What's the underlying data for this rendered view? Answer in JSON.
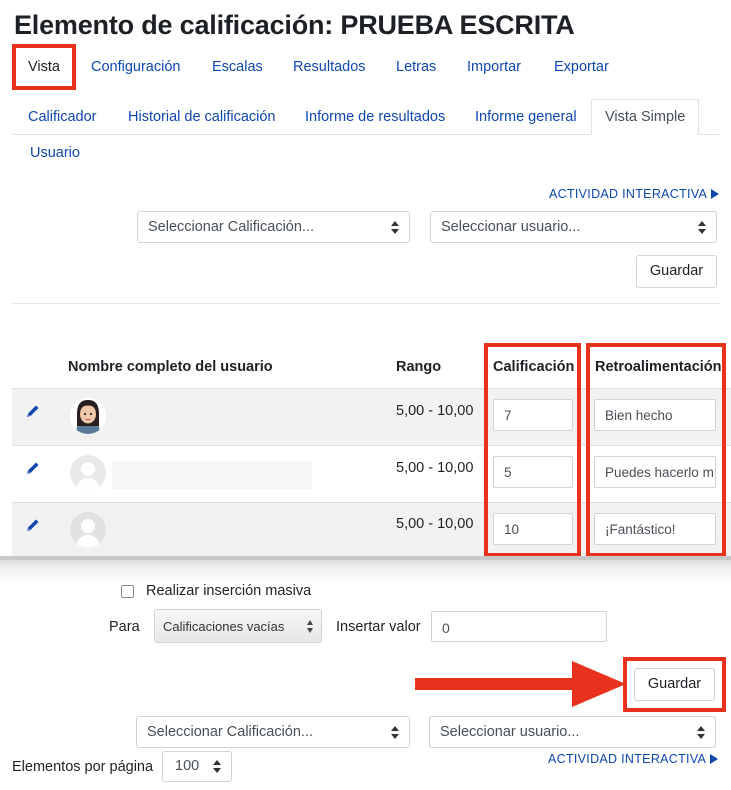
{
  "page_title": "Elemento de calificación: PRUEBA ESCRITA",
  "primary_tabs": [
    {
      "label": "Vista",
      "active": true
    },
    {
      "label": "Configuración"
    },
    {
      "label": "Escalas"
    },
    {
      "label": "Resultados"
    },
    {
      "label": "Letras"
    },
    {
      "label": "Importar"
    },
    {
      "label": "Exportar"
    }
  ],
  "secondary_tabs": [
    {
      "label": "Calificador"
    },
    {
      "label": "Historial de calificación"
    },
    {
      "label": "Informe de resultados"
    },
    {
      "label": "Informe general"
    },
    {
      "label": "Vista Simple",
      "active": true
    },
    {
      "label": "Usuario"
    }
  ],
  "top_nav": {
    "next_activity": "ACTIVIDAD INTERACTIVA",
    "select_grade": "Seleccionar Calificación...",
    "select_user": "Seleccionar usuario...",
    "save": "Guardar"
  },
  "table": {
    "headers": {
      "name": "Nombre completo del usuario",
      "range": "Rango",
      "grade": "Calificación",
      "feedback": "Retroalimentación"
    },
    "rows": [
      {
        "name": "",
        "range": "5,00 - 10,00",
        "grade": "7",
        "feedback": "Bien hecho",
        "avatar": "photo-avatar"
      },
      {
        "name": "",
        "range": "5,00 - 10,00",
        "grade": "5",
        "feedback": "Puedes hacerlo m",
        "avatar": "default-avatar"
      },
      {
        "name": "",
        "range": "5,00 - 10,00",
        "grade": "10",
        "feedback": "¡Fantástico!",
        "avatar": "default-avatar"
      }
    ]
  },
  "bulk_insert": {
    "label": "Realizar inserción masiva",
    "checked": false,
    "for_label": "Para",
    "for_value": "Calificaciones vacías",
    "insert_label": "Insertar valor",
    "insert_value": "0"
  },
  "bottom_nav": {
    "save": "Guardar",
    "select_grade": "Seleccionar Calificación...",
    "select_user": "Seleccionar usuario...",
    "next_activity": "ACTIVIDAD INTERACTIVA",
    "per_page_label": "Elementos por página",
    "per_page_value": "100"
  },
  "colors": {
    "link": "#0f47ad",
    "highlight": "#e8321e",
    "row_shade": "#f2f2f2"
  }
}
